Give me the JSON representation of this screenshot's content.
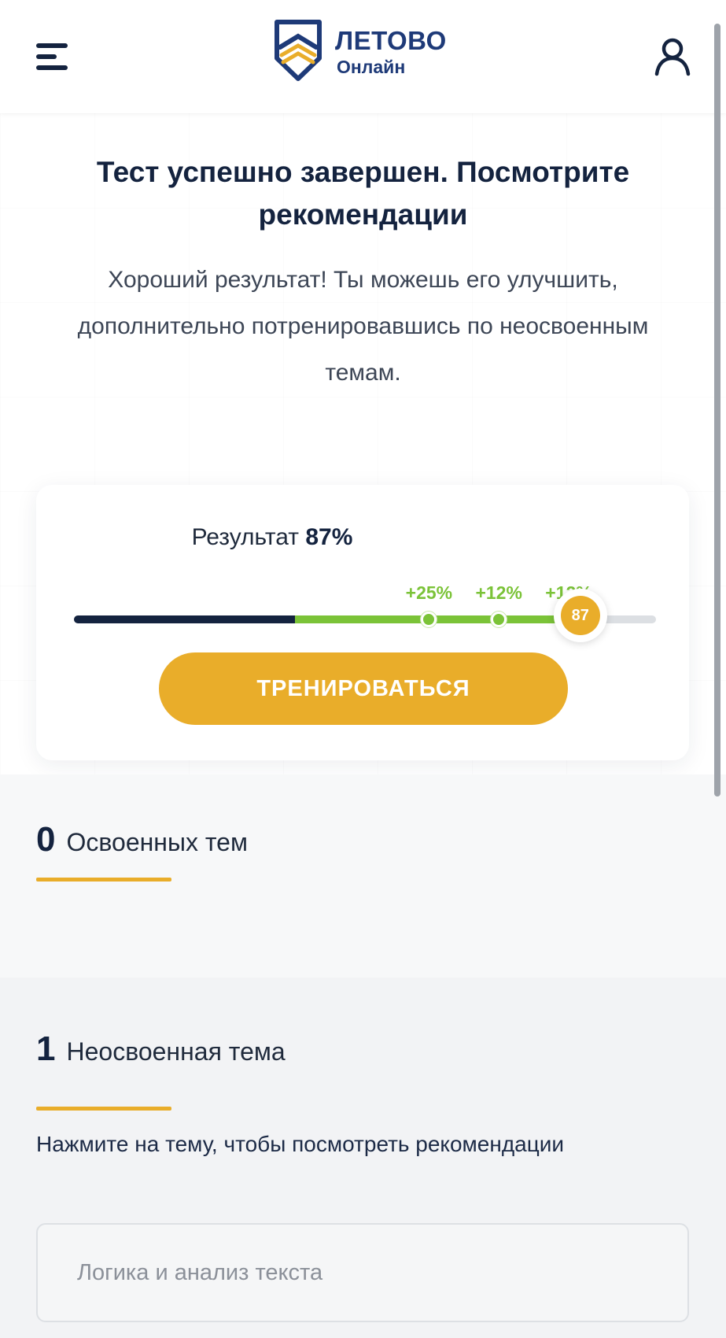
{
  "header": {
    "logo_title": "ЛЕТОВО",
    "logo_subtitle": "Онлайн"
  },
  "hero": {
    "title": "Тест успешно завершен. Посмотрите рекомендации",
    "message": "Хороший результат! Ты  можешь его улучшить, дополнительно потренировавшись по неосвоенным темам."
  },
  "result": {
    "label": "Результат",
    "percent_text": "87%",
    "score": 87,
    "base_percent": 38,
    "gains": [
      {
        "label": "+25%",
        "at_percent": 61
      },
      {
        "label": "+12%",
        "at_percent": 73
      },
      {
        "label": "+12%",
        "at_percent": 85
      }
    ],
    "marker_label": "87",
    "button_label": "ТРЕНИРОВАТЬСЯ"
  },
  "mastered": {
    "count": "0",
    "title": "Освоенных тем"
  },
  "unmastered": {
    "count": "1",
    "title": "Неосвоенная тема",
    "hint": "Нажмите на тему, чтобы посмотреть рекомендации",
    "topics": [
      "Логика и анализ текста"
    ]
  },
  "colors": {
    "navy": "#14233f",
    "brand_blue": "#1e3a78",
    "accent_yellow": "#e9ad2a",
    "gain_green": "#7bc338"
  }
}
